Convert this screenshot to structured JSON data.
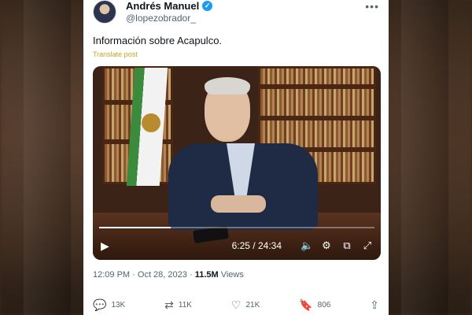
{
  "author": {
    "name": "Andrés Manuel",
    "handle": "@lopezobrador_",
    "verified_icon": "✓"
  },
  "more_icon": "•••",
  "post": {
    "text": "Información sobre Acapulco.",
    "translate_label": "Translate post"
  },
  "video": {
    "time": "6:25 / 24:34",
    "progress": 0.26,
    "icons": {
      "play": "play-icon",
      "volume": "volume-icon",
      "settings": "gear-icon",
      "pip": "picture-in-picture-icon",
      "fullscreen": "fullscreen-icon"
    }
  },
  "meta": {
    "time": "12:09 PM",
    "date": "Oct 28, 2023",
    "views_count": "11.5M",
    "views_label": "Views"
  },
  "actions": {
    "replies": "13K",
    "reposts": "11K",
    "likes": "21K",
    "bookmarks": "806"
  },
  "colors": {
    "verified": "#1d9bf0",
    "translate": "#c9a227",
    "text": "#0f1419",
    "secondary": "#536471"
  }
}
